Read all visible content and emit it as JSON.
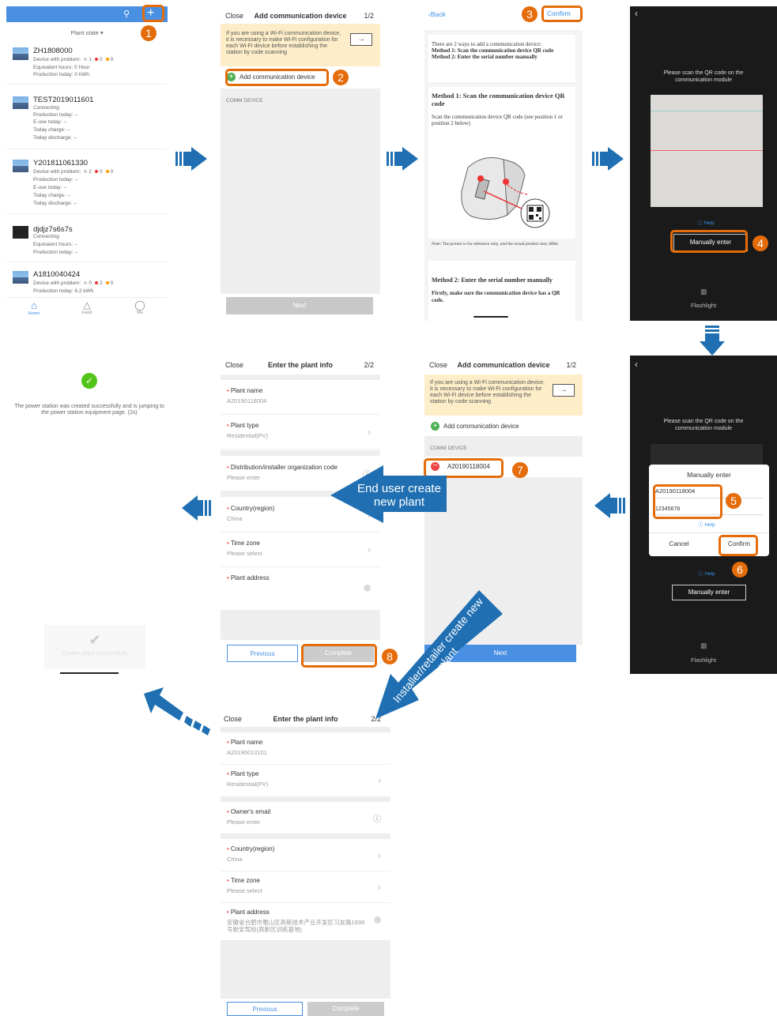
{
  "p1": {
    "plant_state": "Plant state",
    "plants": [
      {
        "name": "ZH1808000",
        "lines": [
          "Device with problem:",
          "Equivalent hours: 0 Hour",
          "Production today: 0 kWh"
        ],
        "counts": [
          "1",
          "0",
          "0"
        ]
      },
      {
        "name": "TEST2019011601",
        "status": "Connecting",
        "lines": [
          "Production today: --",
          "E-use today: --",
          "Today charge: --",
          "Today discharge: --"
        ]
      },
      {
        "name": "Y201811061330",
        "lines": [
          "Device with problem:",
          "Production today: --",
          "E-use today: --",
          "Today charge: --",
          "Today discharge: --"
        ],
        "counts": [
          "2",
          "0",
          "0"
        ]
      },
      {
        "name": "djdjz7s6s7s",
        "status": "Connecting",
        "lines": [
          "Equivalent hours: --",
          "Production today: --"
        ]
      },
      {
        "name": "A1810040424",
        "lines": [
          "Device with problem:",
          "Production today: 6.2 kWh"
        ],
        "counts": [
          "0",
          "2",
          "0"
        ]
      }
    ],
    "tabs": [
      "Home",
      "Fault",
      "Me"
    ]
  },
  "p2": {
    "close": "Close",
    "title": "Add communication device",
    "step": "1/2",
    "banner": "If you are using a Wi-Fi communication device, it is necessary to make Wi-Fi configuration for each Wi-Fi device before establishing the station by code scanning",
    "add_label": "Add communication device",
    "comm_header": "COMM DEVICE",
    "next": "Next"
  },
  "p3": {
    "back": "Back",
    "confirm": "Confirm",
    "intro": "There are 2 ways to add a communication device:",
    "m1": "Method 1: Scan the communication device QR code",
    "m2": "Method 2: Enter the serial number manually",
    "h1": "Method 1: Scan the communication device QR code",
    "p1": "Scan the communication device QR code (see position 1 or position 2 below)",
    "note": "Note: The picture is for reference only, and the actual product may differ.",
    "h2": "Method 2: Enter the serial number manually",
    "p2": "Firstly, make sure the communication device has a QR code."
  },
  "p4": {
    "prompt": "Please scan the QR code on the communication module",
    "help": "Help",
    "manual": "Manually enter",
    "flash": "Flashlight"
  },
  "p5": {
    "prompt": "Please scan the QR code on the communication module",
    "dialog_title": "Manually enter",
    "sn": "A20190118004",
    "code": "12345678",
    "help": "Help",
    "cancel": "Cancel",
    "confirm": "Confirm",
    "manual": "Manually enter",
    "flash": "Flashlight"
  },
  "p6": {
    "close": "Close",
    "title": "Add communication device",
    "step": "1/2",
    "banner": "If you are using a Wi-Fi communication device, it is necessary to make Wi-Fi configuration for each Wi-Fi device before establishing the station by code scanning",
    "add_label": "Add communication device",
    "comm_header": "COMM DEVICE",
    "device": "A20190118004",
    "next": "Next"
  },
  "p7": {
    "close": "Close",
    "title": "Enter the plant info",
    "step": "2/2",
    "fields": [
      {
        "label": "Plant name",
        "value": "A20190118004"
      },
      {
        "label": "Plant type",
        "value": "Residential(PV)"
      },
      {
        "label": "Distribution/installer organization code",
        "value": "Please enter"
      },
      {
        "label": "Country(region)",
        "value": "China"
      },
      {
        "label": "Time zone",
        "value": "Please select"
      },
      {
        "label": "Plant address",
        "value": ""
      }
    ],
    "previous": "Previous",
    "complete": "Complete"
  },
  "p8": {
    "success_msg": "The power station was created successfully and is jumping to the power station equipment page. (2s)",
    "toast": "Create plant successfully"
  },
  "p9": {
    "close": "Close",
    "title": "Enter the plant info",
    "step": "2/2",
    "fields": [
      {
        "label": "Plant name",
        "value": "A20190013101"
      },
      {
        "label": "Plant type",
        "value": "Residential(PV)"
      },
      {
        "label": "Owner's email",
        "value": "Please enter"
      },
      {
        "label": "Country(region)",
        "value": "China"
      },
      {
        "label": "Time zone",
        "value": "Please select"
      },
      {
        "label": "Plant address",
        "value": "安徽省合肥市蜀山区高新技术产业开发区习友路1699号新安驾校(高新区训练基地)"
      }
    ],
    "previous": "Previous",
    "complete": "Complete"
  },
  "annotations": {
    "badges": [
      "1",
      "2",
      "3",
      "4",
      "5",
      "6",
      "7",
      "8"
    ],
    "end_user": "End user create new plant",
    "installer": "Installer/retailer create new plant"
  },
  "colors": {
    "accent": "#3a8ee6",
    "callout": "#e46c0a",
    "arrow": "#1f6fb2"
  }
}
